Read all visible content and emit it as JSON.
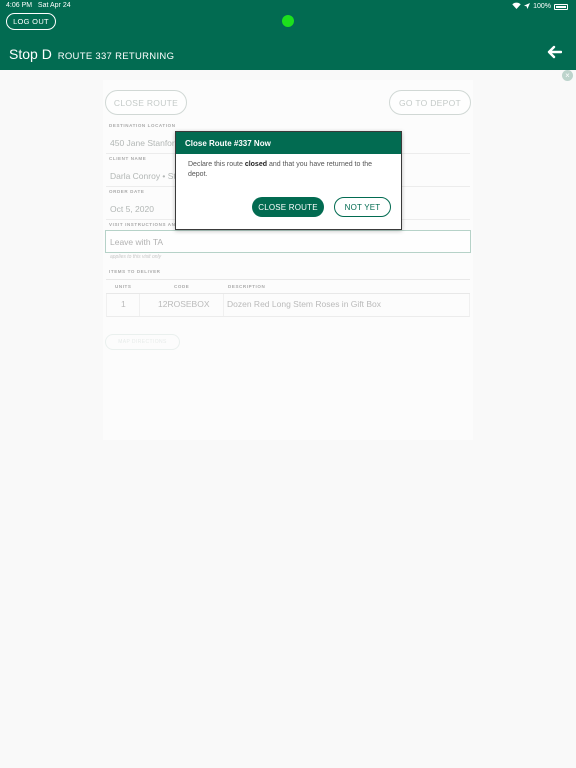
{
  "status_bar": {
    "time": "4:06 PM",
    "date": "Sat Apr 24",
    "battery": "100%"
  },
  "header": {
    "logout_label": "LOG OUT",
    "stop_title": "Stop D",
    "route_subtitle": "ROUTE 337 RETURNING",
    "back_icon": "arrow-left-icon"
  },
  "colors": {
    "brand": "#026b51",
    "indicator": "#1de01d"
  },
  "actions": {
    "close_route_label": "CLOSE ROUTE",
    "go_to_depot_label": "GO TO DEPOT"
  },
  "form": {
    "destination_label": "DESTINATION LOCATION",
    "destination_value": "450 Jane Stanford",
    "client_label": "CLIENT NAME",
    "client_value": "Darla Conroy • St",
    "order_date_label": "ORDER DATE",
    "order_date_value": "Oct 5, 2020",
    "instructions_label": "VISIT INSTRUCTIONS AN",
    "instructions_value": "Leave with TA",
    "instructions_hint": "applies to this visit only",
    "items_label": "ITEMS TO DELIVER"
  },
  "items_table": {
    "headers": [
      "UNITS",
      "CODE",
      "DESCRIPTION"
    ],
    "rows": [
      {
        "units": "1",
        "code": "12ROSEBOX",
        "description": "Dozen Red Long Stem Roses in Gift Box"
      }
    ]
  },
  "faded_button_label": "MAP DIRECTIONS",
  "modal": {
    "title": "Close Route #337 Now",
    "body_prefix": "Declare this route ",
    "body_bold": "closed",
    "body_suffix": " and that you have returned to the depot.",
    "confirm_label": "CLOSE ROUTE",
    "cancel_label": "NOT YET"
  }
}
